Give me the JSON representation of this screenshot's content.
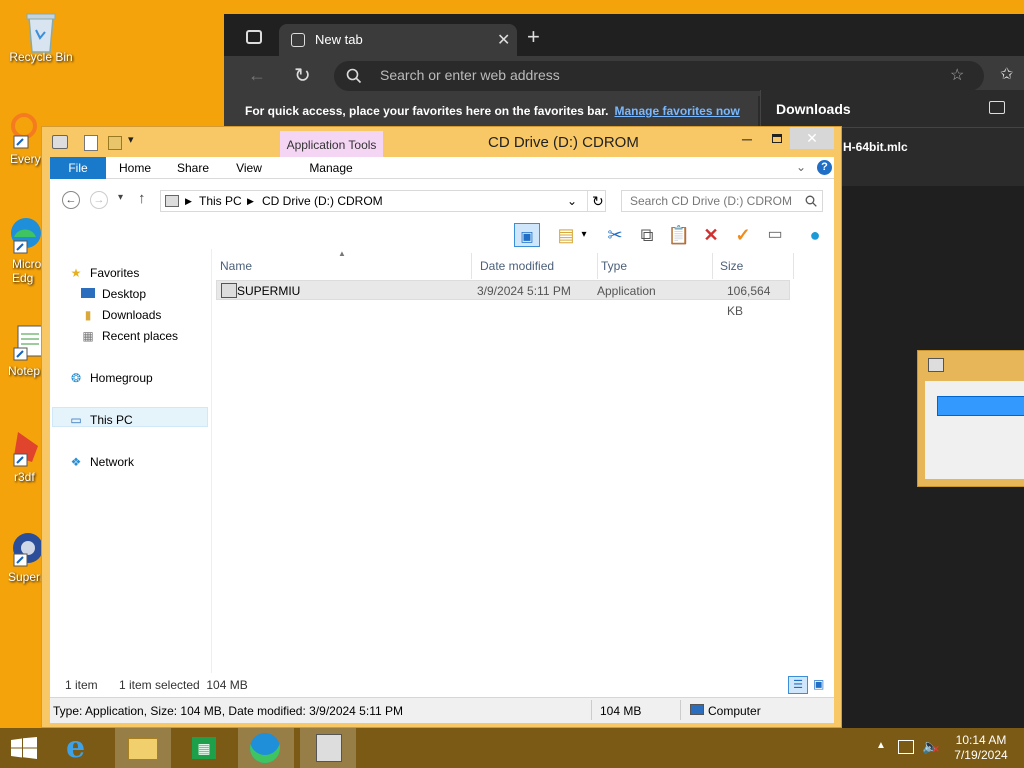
{
  "desktop": {
    "icons": [
      {
        "label": "Recycle Bin"
      },
      {
        "label": "Everyt"
      },
      {
        "label": "Micro\nEdg"
      },
      {
        "label": "Notep"
      },
      {
        "label": "r3df"
      },
      {
        "label": "Superm"
      }
    ]
  },
  "browser": {
    "tab_title": "New tab",
    "address_placeholder": "Search or enter web address",
    "favorites_message": "For quick access, place your favorites here on the favorites bar.",
    "favorites_link": "Manage favorites now",
    "downloads_title": "Downloads",
    "download_item": "H-64bit.mlc"
  },
  "explorer": {
    "title": "CD Drive (D:) CDROM",
    "context_tab_group": "Application Tools",
    "ribbon_tabs": {
      "file": "File",
      "home": "Home",
      "share": "Share",
      "view": "View",
      "manage": "Manage"
    },
    "breadcrumb": [
      "This PC",
      "CD Drive (D:) CDROM"
    ],
    "search_placeholder": "Search CD Drive (D:) CDROM",
    "nav": {
      "favorites": "Favorites",
      "desktop": "Desktop",
      "downloads": "Downloads",
      "recent": "Recent places",
      "homegroup": "Homegroup",
      "thispc": "This PC",
      "network": "Network"
    },
    "columns": {
      "name": "Name",
      "date": "Date modified",
      "type": "Type",
      "size": "Size"
    },
    "files": [
      {
        "name": "SUPERMIU",
        "date": "3/9/2024 5:11 PM",
        "type": "Application",
        "size": "106,564 KB"
      }
    ],
    "status": {
      "items": "1 item",
      "selected": "1 item selected  104 MB"
    },
    "details_bar": {
      "info": "Type: Application, Size: 104 MB, Date modified: 3/9/2024 5:11 PM",
      "size": "104 MB",
      "location": "Computer"
    }
  },
  "taskbar": {
    "time": "10:14 AM",
    "date": "7/19/2024"
  },
  "colors": {
    "desktop": "#f5a30a",
    "window_frame": "#f9c866",
    "file_tab": "#1979ca",
    "context_tab": "#f4d6f4",
    "taskbar": "#7a5a14"
  }
}
